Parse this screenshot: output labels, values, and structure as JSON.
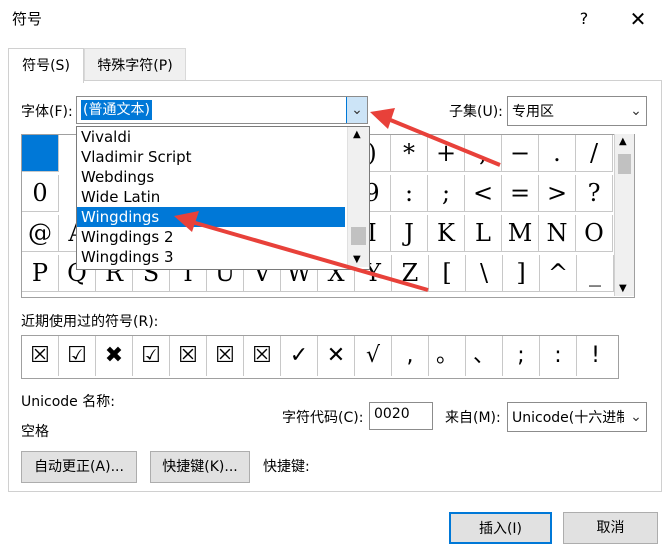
{
  "window": {
    "title": "符号",
    "help": "?",
    "close": "✕"
  },
  "tabs": [
    {
      "label": "符号(S)"
    },
    {
      "label": "特殊字符(P)"
    }
  ],
  "font": {
    "label": "字体(F):",
    "value": "(普通文本)"
  },
  "subset": {
    "label": "子集(U):",
    "value": "专用区"
  },
  "font_dropdown": {
    "items": [
      "Vivaldi",
      "Vladimir Script",
      "Webdings",
      "Wide Latin",
      "Wingdings",
      "Wingdings 2",
      "Wingdings 3"
    ],
    "selected": "Wingdings"
  },
  "symbol_grid": {
    "rows": [
      [
        "",
        "",
        "",
        "",
        "",
        "",
        "",
        "",
        ")",
        "*",
        "+",
        ",",
        "−",
        ".",
        "/"
      ],
      [
        "0",
        "",
        "",
        "",
        "",
        "",
        "",
        "",
        "9",
        ":",
        ";",
        "<",
        "=",
        ">",
        "?"
      ],
      [
        "@",
        "A",
        "",
        "",
        "",
        "",
        "",
        "",
        "I",
        "J",
        "K",
        "L",
        "M",
        "N",
        "O"
      ],
      [
        "P",
        "Q",
        "R",
        "S",
        "T",
        "U",
        "V",
        "W",
        "X",
        "Y",
        "Z",
        "[",
        "\\",
        "]",
        "^",
        "_"
      ]
    ]
  },
  "recent": {
    "label": "近期使用过的符号(R):",
    "symbols": [
      "☒",
      "☑",
      "✖",
      "☑",
      "☒",
      "☒",
      "☒",
      "✓",
      "✕",
      "√",
      ",",
      "。",
      "、",
      ";",
      ":",
      "!"
    ]
  },
  "unicode_name": {
    "label": "Unicode 名称:",
    "value": "空格"
  },
  "char_code": {
    "label": "字符代码(C):",
    "value": "0020"
  },
  "from": {
    "label": "来自(M):",
    "value": "Unicode(十六进制)"
  },
  "buttons": {
    "autocorrect": "自动更正(A)...",
    "shortcut_key": "快捷键(K)...",
    "shortcut_label": "快捷键:",
    "insert": "插入(I)",
    "cancel": "取消"
  },
  "colors": {
    "accent": "#0078d7",
    "arrow": "#e8413a"
  }
}
